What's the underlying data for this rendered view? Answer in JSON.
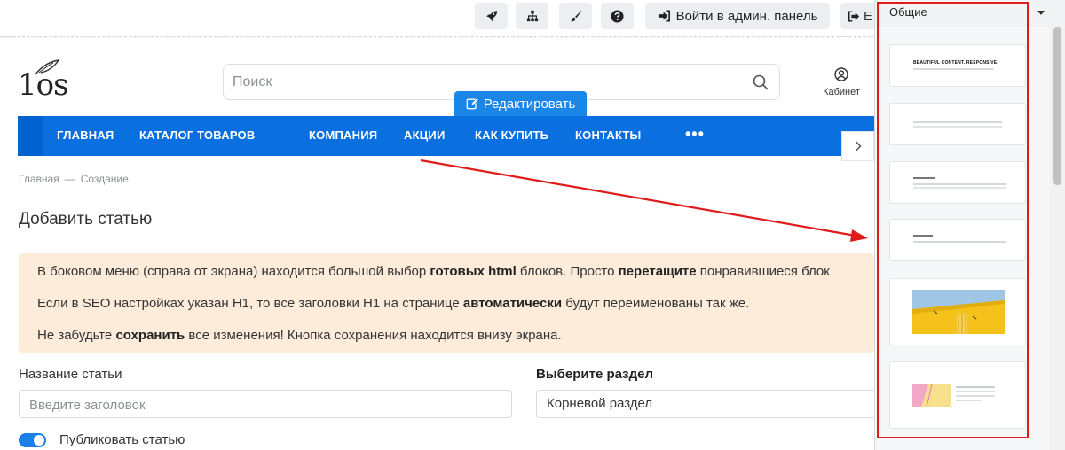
{
  "toolbar": {
    "login_label": "Войти в админ. панель",
    "edge_label": "Е"
  },
  "header": {
    "logo_text": "1os",
    "search_placeholder": "Поиск",
    "cabinet_label": "Кабинет",
    "edit_label": "Редактировать"
  },
  "nav": {
    "items": [
      "ГЛАВНАЯ",
      "КАТАЛОГ ТОВАРОВ",
      "КОМПАНИЯ",
      "АКЦИИ",
      "КАК КУПИТЬ",
      "КОНТАКТЫ"
    ],
    "more": "•••"
  },
  "breadcrumb": {
    "home": "Главная",
    "separator": "—",
    "current": "Создание"
  },
  "page": {
    "title": "Добавить статью"
  },
  "notice": {
    "line1": {
      "a": "В боковом меню (справа от экрана) находится большой выбор ",
      "b": "готовых html",
      "c": " блоков. Просто ",
      "d": "перетащите",
      "e": " понравившиеся блок"
    },
    "line2": {
      "a": "Если в SEO настройках указан H1, то все заголовки H1 на странице ",
      "b": "автоматически",
      "c": " будут переименованы так же."
    },
    "line3": {
      "a": "Не забудьте ",
      "b": "сохранить",
      "c": " все изменения! Кнопка сохранения находится внизу экрана."
    }
  },
  "form": {
    "title_label": "Название статьи",
    "title_placeholder": "Введите заголовок",
    "section_label": "Выберите раздел",
    "section_value": "Корневой раздел",
    "publish_label": "Публиковать статью",
    "publish_on": true
  },
  "sidebar": {
    "category": "Общие",
    "blocks": [
      {
        "heading": "BEAUTIFUL CONTENT. RESPONSIVE."
      },
      {
        "heading": ""
      },
      {
        "heading": ""
      },
      {
        "heading": ""
      },
      {
        "heading": ""
      },
      {
        "heading": ""
      }
    ]
  },
  "colors": {
    "nav": "#0a70e0",
    "edit_button": "#1a86e8",
    "notice_bg": "#fdecda",
    "annotation": "#e01b1b",
    "toggle": "#1a7fe6"
  },
  "icons": {
    "toolbar": [
      "rocket-icon",
      "sitemap-icon",
      "brush-icon",
      "question-icon",
      "sign-in-icon"
    ],
    "search": "search-icon",
    "cabinet": "user-circle-icon",
    "edit": "edit-icon",
    "nav_arrow": "chevron-right-icon"
  }
}
